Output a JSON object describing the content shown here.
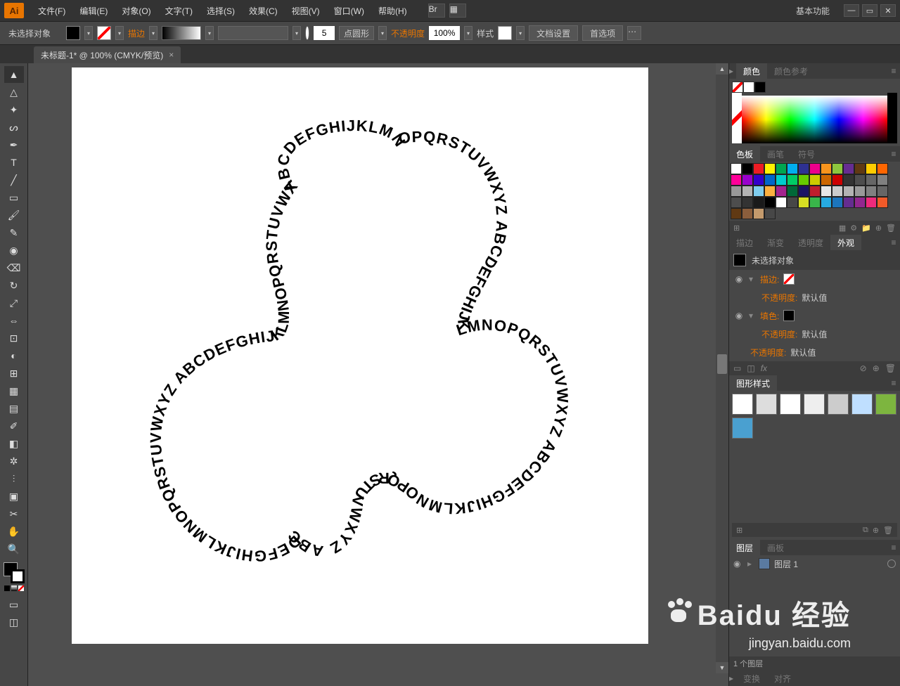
{
  "menubar": {
    "logo": "Ai",
    "items": [
      "文件(F)",
      "编辑(E)",
      "对象(O)",
      "文字(T)",
      "选择(S)",
      "效果(C)",
      "视图(V)",
      "窗口(W)",
      "帮助(H)"
    ],
    "workspace": "基本功能"
  },
  "ctrlbar": {
    "selection": "未选择对象",
    "stroke_label": "描边",
    "stroke_weight": "5",
    "stroke_profile": "点圆形",
    "opacity_label": "不透明度",
    "opacity_value": "100%",
    "style_label": "样式",
    "doc_setup": "文档设置",
    "prefs": "首选项"
  },
  "document_tab": {
    "title": "未标题-1* @ 100% (CMYK/预览)"
  },
  "canvas": {
    "path_text": "ABCDEFGHIJKLMNOPQRSTUVWXYZ ABCDEFGHIJKLMNOPQRSTUVWXYZ ABCDEFGHIJKLMNOPQRSTUVWXYZ ABCDEFGHIJKLMNOPQRSTUVWXYZ ABCDEFGHIJKLMNOPQRSTUVWXYZ"
  },
  "panels": {
    "color": {
      "tabs": [
        "颜色",
        "颜色参考"
      ]
    },
    "swatches": {
      "tabs": [
        "色板",
        "画笔",
        "符号"
      ]
    },
    "appearance": {
      "tabs": [
        "描边",
        "渐变",
        "透明度",
        "外观"
      ],
      "header": "未选择对象",
      "stroke": "描边:",
      "fill": "填色:",
      "opacity": "不透明度:",
      "default": "默认值"
    },
    "graphicstyles": {
      "tab": "图形样式"
    },
    "layers": {
      "tabs": [
        "图层",
        "画板"
      ],
      "layer_name": "图层 1",
      "footer": "1 个图层"
    },
    "transform": {
      "tabs": [
        "变换",
        "对齐"
      ]
    }
  },
  "watermark": {
    "brand": "Baidu",
    "label": "经验",
    "url": "jingyan.baidu.com"
  },
  "swatch_colors": [
    "#ffffff",
    "#000000",
    "#ed1c24",
    "#fff200",
    "#00a651",
    "#00aeef",
    "#2e3192",
    "#ec008c",
    "#f7941d",
    "#8dc63e",
    "#662d91",
    "#603913",
    "#ffcc00",
    "#ff6600",
    "#ff0099",
    "#9900cc",
    "#3300cc",
    "#0066cc",
    "#00cccc",
    "#00cc66",
    "#66cc00",
    "#cccc00",
    "#cc6600",
    "#cc0000",
    "#333333",
    "#4d4d4d",
    "#666666",
    "#808080",
    "#999999",
    "#b3b3b3",
    "#7fcdee",
    "#fbb040",
    "#a3238e",
    "#006838",
    "#1b1464",
    "#be1e2d",
    "#e6e6e6",
    "#cccccc",
    "#b3b3b3",
    "#999999",
    "#808080",
    "#666666",
    "#4d4d4d",
    "#333333",
    "#1a1a1a",
    "#000000",
    "#ffffff",
    "",
    "#d7df23",
    "#39b54a",
    "#27aae1",
    "#1c75bc",
    "#652d90",
    "#92278f",
    "#ee2a7b",
    "#f15a29",
    "#603913",
    "#8b5e3c",
    "#c49a6c",
    ""
  ],
  "style_thumbs": [
    "#fff",
    "#ddd",
    "#fff",
    "#eee",
    "#ccc",
    "#bfdfff",
    "#7db53f",
    "#4aa0d0"
  ]
}
